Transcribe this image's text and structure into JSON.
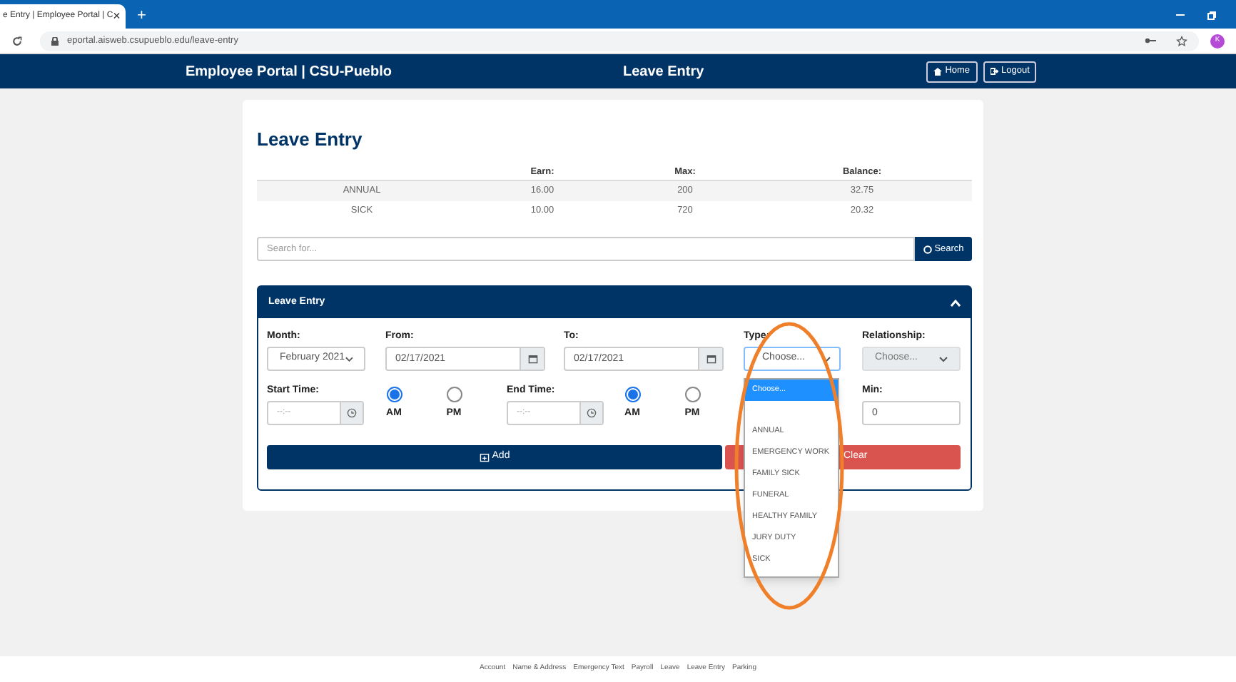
{
  "browser": {
    "tab_title": "e Entry | Employee Portal | C",
    "tab_close": "×",
    "new_tab": "+",
    "url": "eportal.aisweb.csupueblo.edu/leave-entry",
    "avatar": "K"
  },
  "navbar": {
    "brand": "Employee Portal | CSU-Pueblo",
    "page_title": "Leave Entry",
    "buttons": [
      {
        "label": "Home",
        "kind": "home"
      },
      {
        "label": "Logout",
        "kind": "logout"
      }
    ]
  },
  "title": "Leave Entry",
  "balances": {
    "columns": [
      "",
      "Earn:",
      "Max:",
      "Balance:"
    ],
    "rows": [
      [
        "ANNUAL",
        "16.00",
        "200",
        "32.75"
      ],
      [
        "SICK",
        "10.00",
        "720",
        "20.32"
      ]
    ]
  },
  "search": {
    "placeholder": "Search for...",
    "button": "Search"
  },
  "panel": {
    "title": "Leave Entry",
    "expanded": true
  },
  "month": {
    "label": "Month:",
    "value": "February 2021"
  },
  "from": {
    "label": "From:",
    "value": "02/17/2021"
  },
  "to": {
    "label": "To:",
    "value": "02/17/2021"
  },
  "type": {
    "label": "Type:",
    "value": "Choose..."
  },
  "relationship": {
    "label": "Relationship:",
    "value": "Choose...",
    "disabled": true
  },
  "start_time": {
    "label": "Start Time:",
    "placeholder": "--:--",
    "periods": [
      {
        "label": "AM",
        "selected": true
      },
      {
        "label": "PM",
        "selected": false
      }
    ]
  },
  "end_time": {
    "label": "End Time:",
    "placeholder": "--:--",
    "periods": [
      {
        "label": "AM",
        "selected": true
      },
      {
        "label": "PM",
        "selected": false
      }
    ]
  },
  "min": {
    "label": "Min:",
    "value": "0"
  },
  "add_button": "Add",
  "clear_button": "Clear",
  "type_options": [
    {
      "label": "Choose...",
      "selected": true
    },
    {
      "label": "ANNUAL",
      "selected": false
    },
    {
      "label": "EMERGENCY WORK",
      "selected": false
    },
    {
      "label": "FAMILY SICK",
      "selected": false
    },
    {
      "label": "FUNERAL",
      "selected": false
    },
    {
      "label": "HEALTHY FAMILY",
      "selected": false
    },
    {
      "label": "JURY DUTY",
      "selected": false
    },
    {
      "label": "SICK",
      "selected": false
    }
  ],
  "footer_links": [
    "Account",
    "Name & Address",
    "Emergency Text",
    "Payroll",
    "Leave",
    "Leave Entry",
    "Parking"
  ]
}
